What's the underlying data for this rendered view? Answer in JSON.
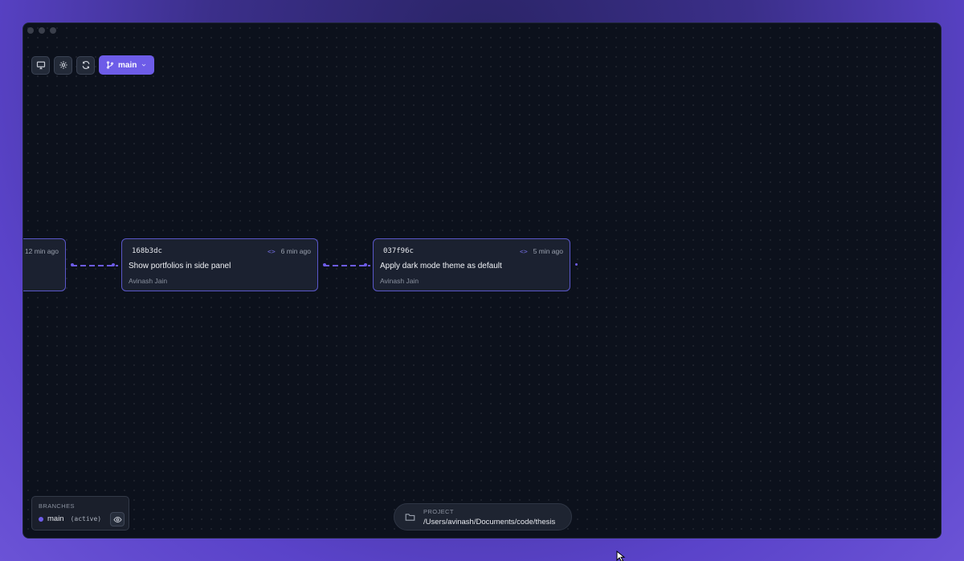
{
  "toolbar": {
    "branch_label": "main"
  },
  "commits": [
    {
      "time": "12 min ago"
    },
    {
      "hash": "168b3dc",
      "time": "6 min ago",
      "message": "Show portfolios in side panel",
      "author": "Avinash Jain"
    },
    {
      "hash": "037f96c",
      "time": "5 min ago",
      "message": "Apply dark mode theme as default",
      "author": "Avinash Jain"
    }
  ],
  "branches_panel": {
    "header": "BRANCHES",
    "items": [
      {
        "name": "main",
        "status": "(active)"
      }
    ]
  },
  "project": {
    "label": "PROJECT",
    "path": "/Users/avinash/Documents/code/thesis"
  },
  "colors": {
    "accent": "#6d5ce8",
    "window_bg": "#0c111c",
    "node_bg": "#1b2130",
    "node_border": "#5a57c9"
  }
}
